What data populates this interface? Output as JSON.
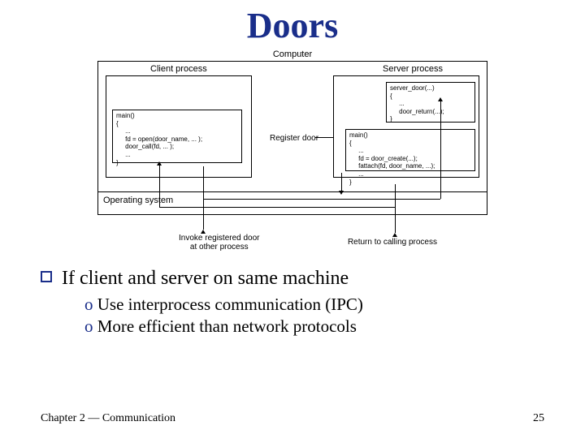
{
  "title": "Doors",
  "diagram": {
    "computer": "Computer",
    "client_process": "Client process",
    "server_process": "Server process",
    "os": "Operating system",
    "register_door": "Register door",
    "invoke": "Invoke registered door\nat other process",
    "return_call": "Return to calling process",
    "client_main_code": "main()\n{\n     ...\n     fd = open(door_name, ... );\n     door_call(fd, ... );\n     ...\n}",
    "server_door_code": "server_door(...)\n{\n     ...\n     door_return(...);\n}",
    "server_main_code": "main()\n{\n     ...\n     fd = door_create(...);\n     fattach(fd, door_name, ...);\n     ...\n}"
  },
  "bullets": {
    "lvl1": "If client and server on same machine",
    "lvl2a": "Use interprocess communication (IPC)",
    "lvl2b": "More efficient than network protocols"
  },
  "footer": {
    "chapter": "Chapter 2 — Communication",
    "page": "25"
  }
}
